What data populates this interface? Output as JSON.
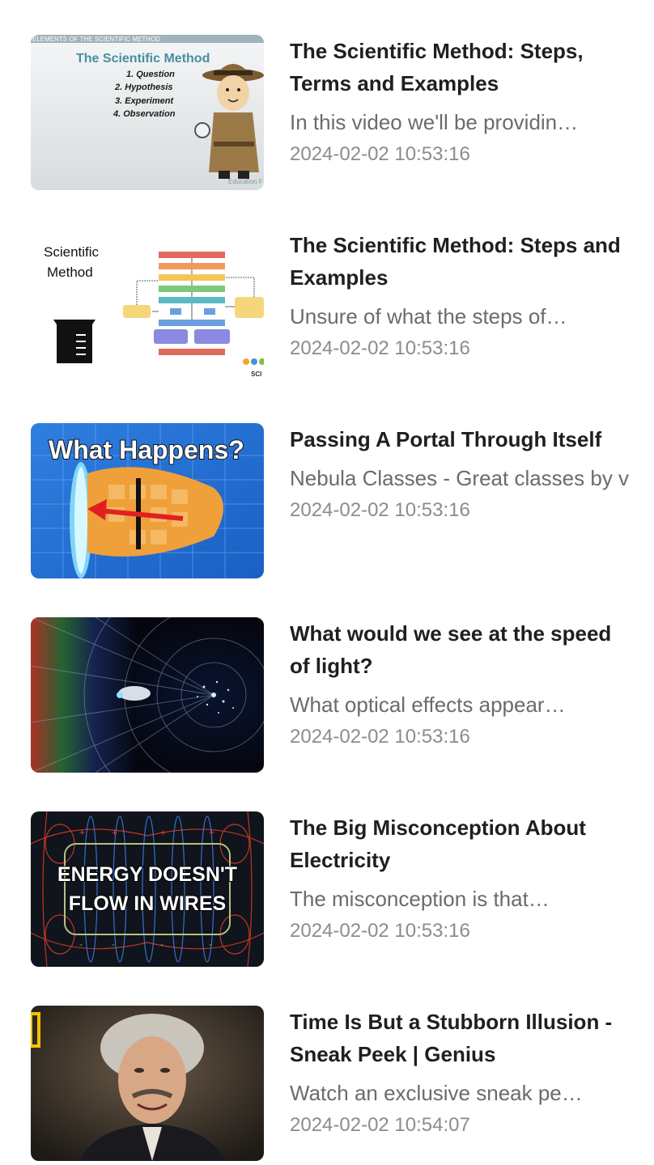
{
  "videos": [
    {
      "title": "The Scientific Method: Steps, Terms and Examples",
      "description": "In this video we'll be providin…",
      "date": "2024-02-02 10:53:16",
      "thumbnail": {
        "banner": "ELEMENTS OF THE SCIENTIFIC METHOD",
        "heading": "The Scientific Method",
        "steps": [
          "1. Question",
          "2. Hypothesis",
          "3. Experiment",
          "4. Observation"
        ],
        "credit": "Education F"
      }
    },
    {
      "title": "The Scientific Method: Steps and Examples",
      "description": "Unsure of what the steps of…",
      "date": "2024-02-02 10:53:16",
      "thumbnail": {
        "label_line1": "Scientific",
        "label_line2": "Method",
        "logo_text": "SCI"
      }
    },
    {
      "title": "Passing A Portal Through Itself",
      "description": "Nebula Classes - Great classes by v",
      "date": "2024-02-02 10:53:16",
      "thumbnail": {
        "caption": "What Happens?"
      }
    },
    {
      "title": "What would we see at the speed of light?",
      "description": "What optical effects appear…",
      "date": "2024-02-02 10:53:16",
      "thumbnail": {}
    },
    {
      "title": "The Big Misconception About Electricity",
      "description": "The misconception is that…",
      "date": "2024-02-02 10:53:16",
      "thumbnail": {
        "line1": "ENERGY DOESN'T",
        "line2": "FLOW IN WIRES"
      }
    },
    {
      "title": "Time Is But a Stubborn Illusion - Sneak Peek | Genius",
      "description": "Watch an exclusive sneak pe…",
      "date": "2024-02-02 10:54:07",
      "thumbnail": {}
    }
  ],
  "colors": {
    "title": "#1f1f1f",
    "description": "#6b6b6b",
    "date": "#8c8c8c",
    "background": "#ffffff"
  }
}
